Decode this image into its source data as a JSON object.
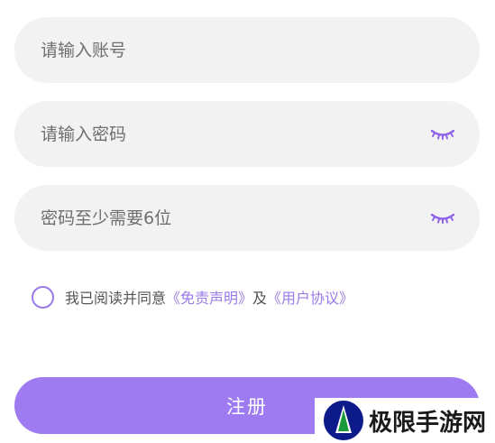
{
  "form": {
    "account_placeholder": "请输入账号",
    "password_placeholder": "请输入密码",
    "confirm_placeholder": "密码至少需要6位",
    "password_toggle_icon": "eye-closed-icon",
    "confirm_toggle_icon": "eye-closed-icon"
  },
  "agreement": {
    "checked": false,
    "prefix": "我已阅读并同意",
    "disclaimer_link": "《免责声明》",
    "connector": "及",
    "user_agreement_link": "《用户协议》"
  },
  "register_button": {
    "label": "注册"
  },
  "watermark": {
    "text": "极限手游网",
    "logo_icon": "site-logo-icon"
  },
  "colors": {
    "accent": "#9e7bf0",
    "link": "#9a7ae6",
    "field_background": "#f2f2f2",
    "placeholder": "#6f6f6f",
    "agreement_text": "#555555"
  }
}
